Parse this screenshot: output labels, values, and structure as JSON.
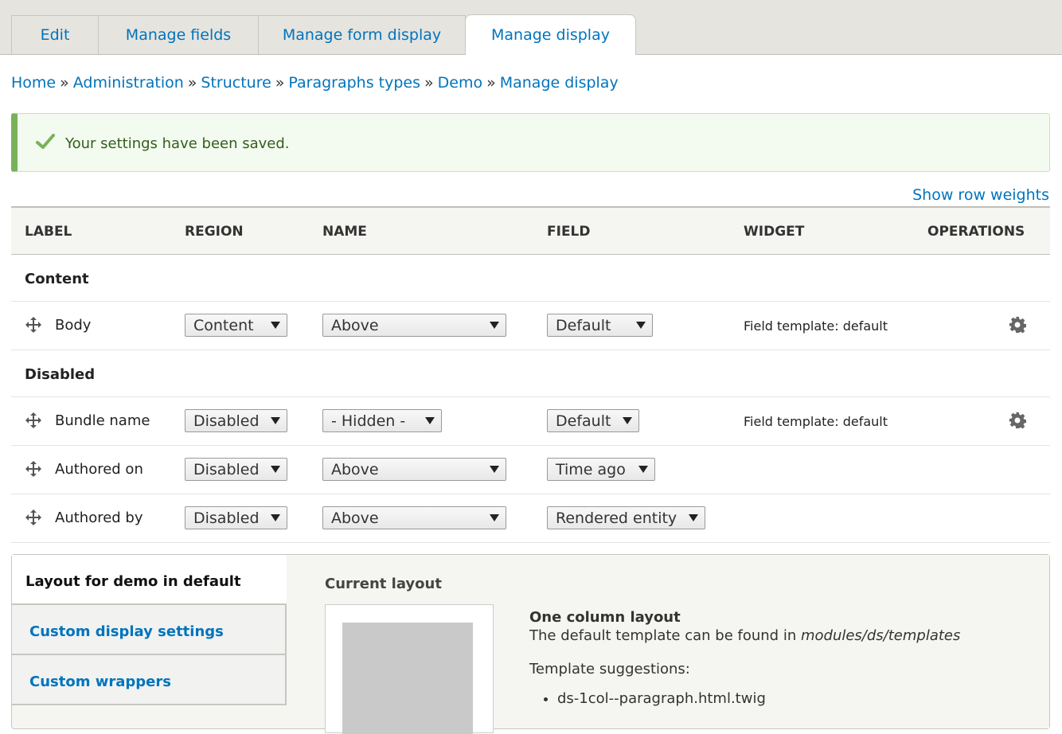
{
  "tabs": [
    {
      "label": "Edit"
    },
    {
      "label": "Manage fields"
    },
    {
      "label": "Manage form display"
    },
    {
      "label": "Manage display",
      "active": true
    }
  ],
  "breadcrumb": [
    "Home",
    "Administration",
    "Structure",
    "Paragraphs types",
    "Demo",
    "Manage display"
  ],
  "breadcrumb_sep": "»",
  "message": {
    "text": "Your settings have been saved.",
    "status_color": "#77b259"
  },
  "show_row_weights": "Show row weights",
  "table": {
    "headers": {
      "label": "LABEL",
      "region": "REGION",
      "name": "NAME",
      "field": "FIELD",
      "widget": "WIDGET",
      "operations": "OPERATIONS"
    },
    "sections": {
      "content": "Content",
      "disabled": "Disabled"
    },
    "rows": [
      {
        "name": "Body",
        "region": "Content",
        "label_display": "Above",
        "formatter": "Default",
        "widget": "Field template: default",
        "has_settings": true
      },
      {
        "name": "Bundle name",
        "region": "Disabled",
        "label_display": "- Hidden -",
        "formatter": "Default",
        "widget": "Field template: default",
        "has_settings": true
      },
      {
        "name": "Authored on",
        "region": "Disabled",
        "label_display": "Above",
        "formatter": "Time ago",
        "widget": "",
        "has_settings": false
      },
      {
        "name": "Authored by",
        "region": "Disabled",
        "label_display": "Above",
        "formatter": "Rendered entity",
        "widget": "",
        "has_settings": false
      }
    ]
  },
  "vertical_tabs": {
    "items": [
      {
        "label": "Layout for demo in default",
        "active": true
      },
      {
        "label": "Custom display settings"
      },
      {
        "label": "Custom wrappers"
      }
    ],
    "pane": {
      "current_layout_label": "Current layout",
      "layout_title": "One column layout",
      "layout_desc_prefix": "The default template can be found in",
      "layout_desc_path": "modules/ds/templates",
      "suggestions_label": "Template suggestions:",
      "suggestions": [
        "ds-1col--paragraph.html.twig"
      ]
    }
  },
  "colors": {
    "link": "#0074bd",
    "success_text": "#325e1c"
  },
  "icons": {
    "drag": "move-arrows-icon",
    "settings": "gear-icon",
    "success": "checkmark-icon",
    "dropdown": "triangle-down-icon"
  }
}
